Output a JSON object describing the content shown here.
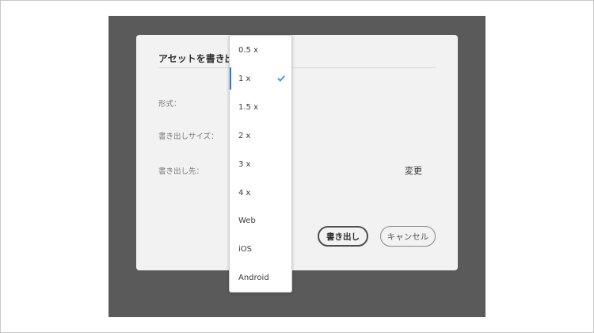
{
  "dialog": {
    "title": "アセットを書き出し",
    "labels": {
      "format": "形式：",
      "export_size": "書き出しサイズ：",
      "export_dest": "書き出し先："
    },
    "change_link": "変更",
    "export_button": "書き出し",
    "cancel_button": "キャンセル"
  },
  "dropdown": {
    "selected": "1 x",
    "items": [
      "0.5 x",
      "1 x",
      "1.5 x",
      "2 x",
      "3 x",
      "4 x",
      "Web",
      "iOS",
      "Android"
    ]
  },
  "colors": {
    "accent": "#2b7bd6",
    "backdrop": "#5a5a5a",
    "dialog_bg": "#f2f2f2"
  },
  "icons": {
    "selected_indicator": "check-icon"
  }
}
